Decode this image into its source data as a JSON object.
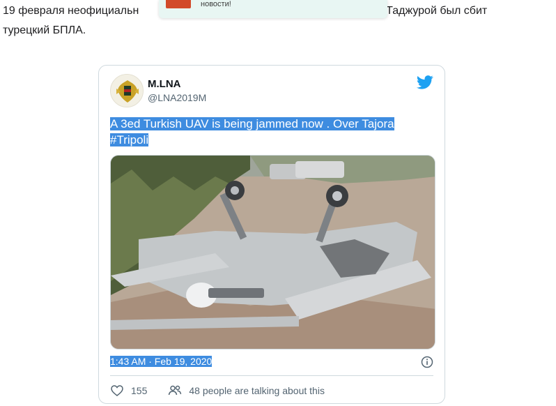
{
  "article": {
    "line1_start": "19 февраля неофициальн",
    "line1_end": "о над Таджурой был сбит",
    "line2": "турецкий БПЛА."
  },
  "toast": {
    "text": "новости!"
  },
  "tweet": {
    "display_name": "M.LNA",
    "handle": "@LNA2019M",
    "text_line1": "A 3ed Turkish UAV is being jammed now . Over Tajora",
    "text_line2": "#Tripoli",
    "timestamp": "1:43 AM · Feb 19, 2020",
    "like_count": "155",
    "conversation": "48 people are talking about this"
  },
  "colors": {
    "twitter_blue": "#1da1f2",
    "selection": "#3e8ce0",
    "like_icon": "#536471"
  },
  "icons": {
    "brand": "twitter-bird-icon",
    "info": "info-icon",
    "like": "heart-icon",
    "conversation": "people-icon"
  }
}
